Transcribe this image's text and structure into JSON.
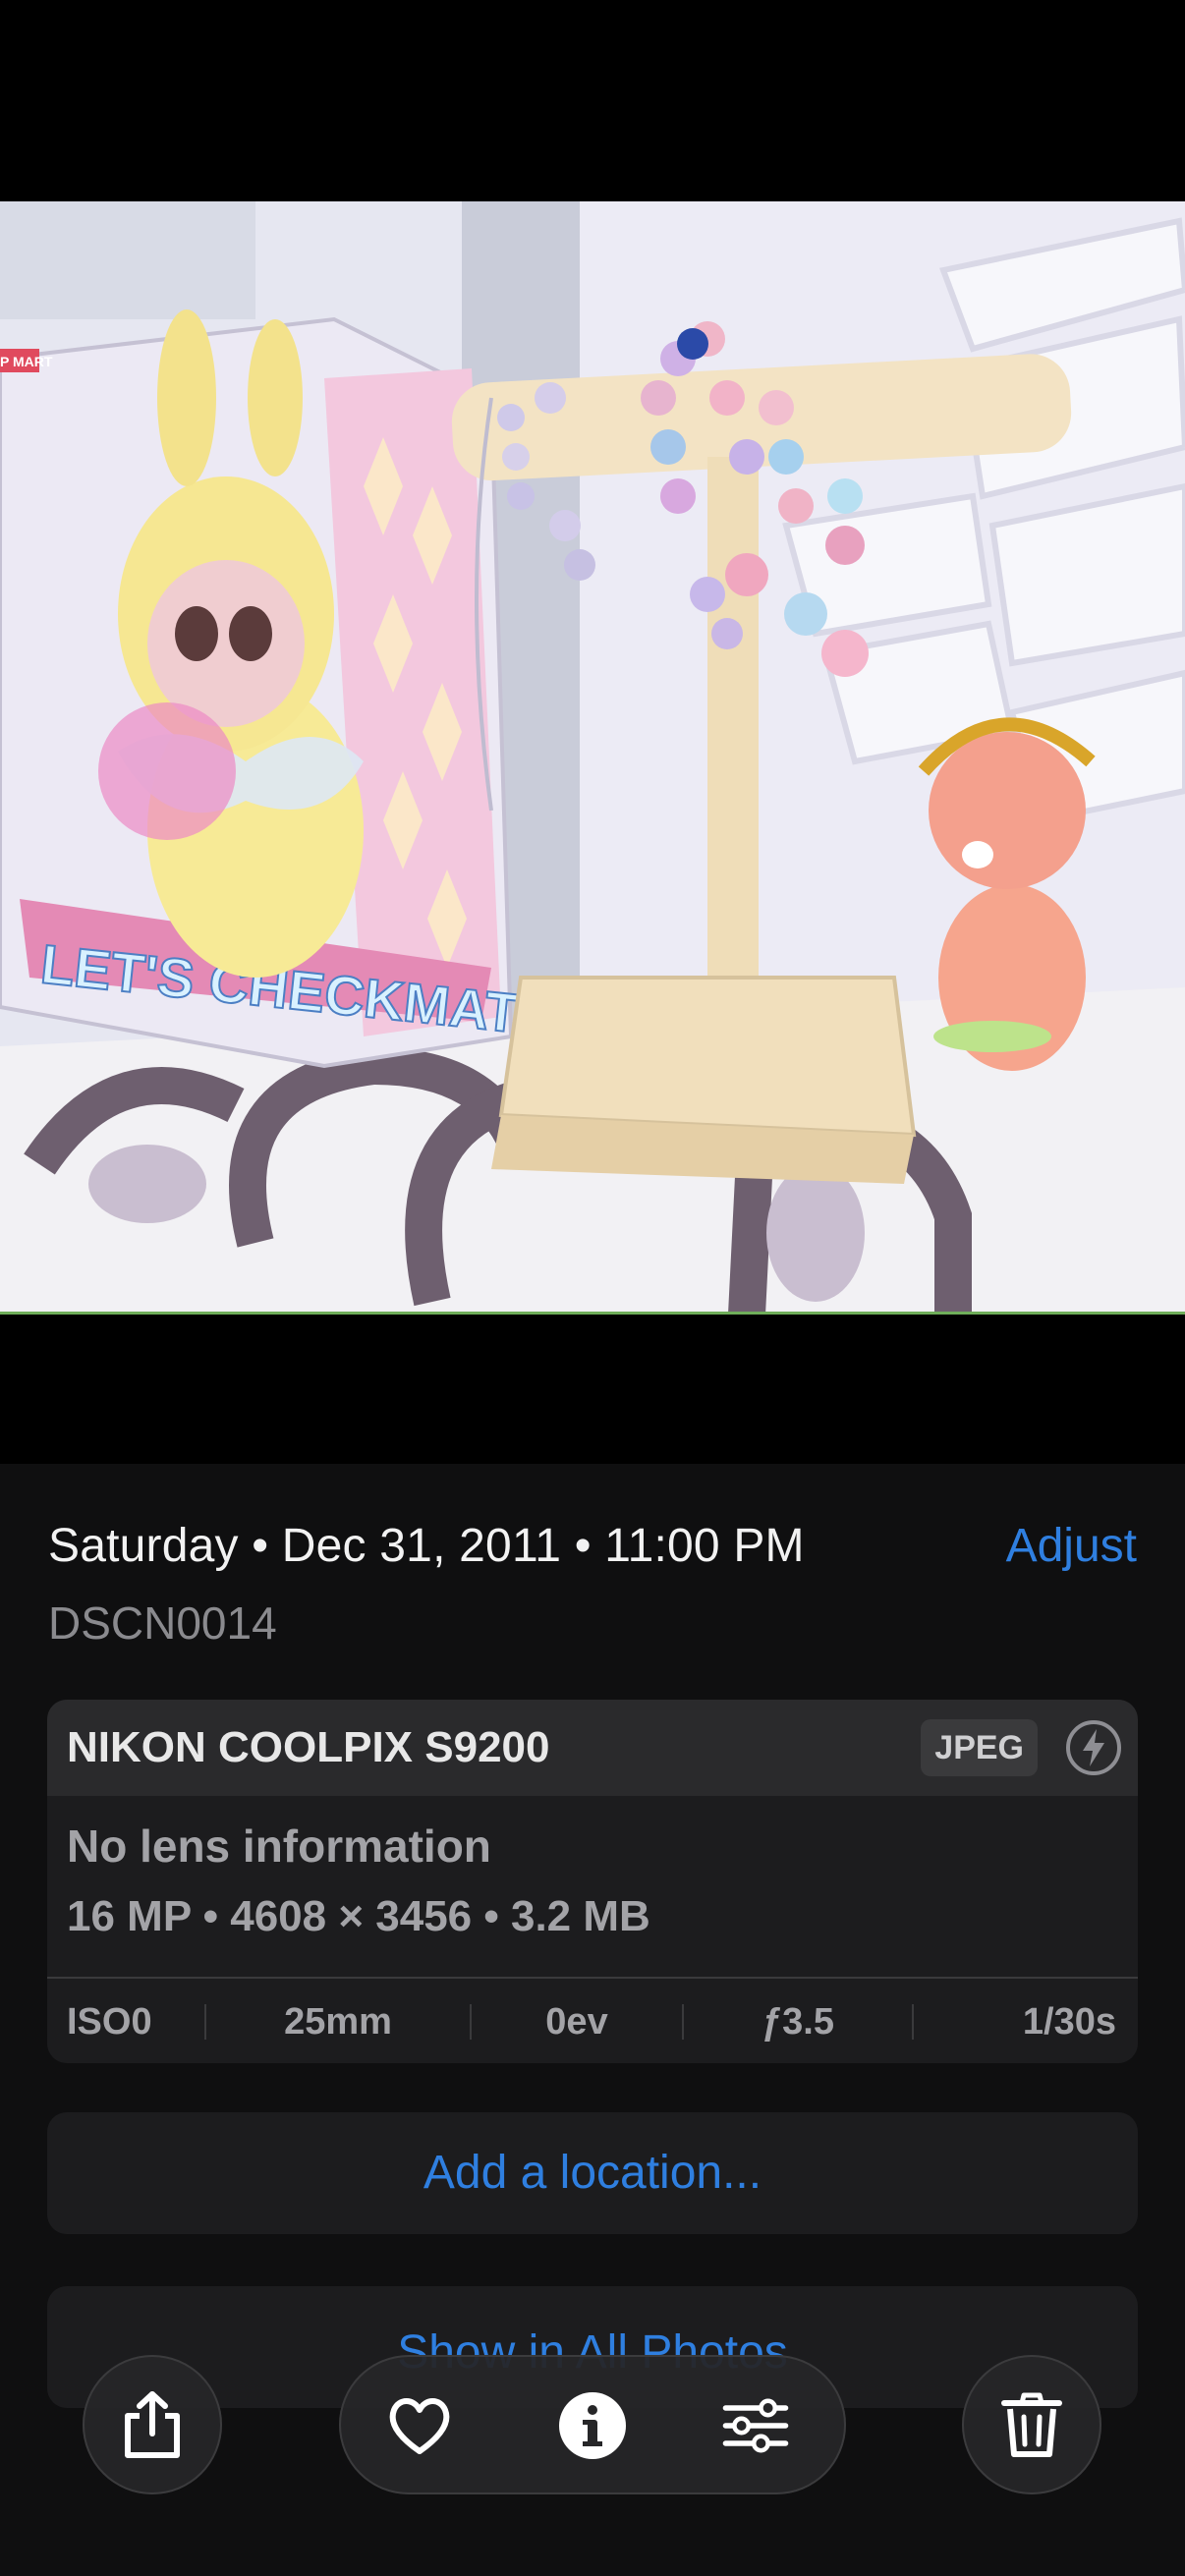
{
  "photo": {
    "box_text": "LET'S CHECKMATE",
    "box_corner_text": "P MART"
  },
  "info": {
    "date_line": "Saturday • Dec 31, 2011 • 11:00 PM",
    "adjust_label": "Adjust",
    "filename": "DSCN0014"
  },
  "camera": {
    "model": "NIKON COOLPIX S9200",
    "format_badge": "JPEG",
    "lens": "No lens information",
    "specs": "16 MP • 4608 × 3456 • 3.2 MB",
    "exif": {
      "iso": "ISO0",
      "focal_length": "25mm",
      "exposure_bias": "0ev",
      "aperture": "ƒ3.5",
      "shutter": "1/30s"
    }
  },
  "actions": {
    "add_location": "Add a location...",
    "show_in_all_photos": "Show in All Photos"
  },
  "toolbar": {
    "icons": [
      "share-icon",
      "heart-icon",
      "info-icon",
      "sliders-icon",
      "trash-icon"
    ]
  },
  "colors": {
    "accent": "#2f7fe0",
    "background": "#000000",
    "panel": "#0f0f10",
    "card": "#1c1c1e"
  }
}
